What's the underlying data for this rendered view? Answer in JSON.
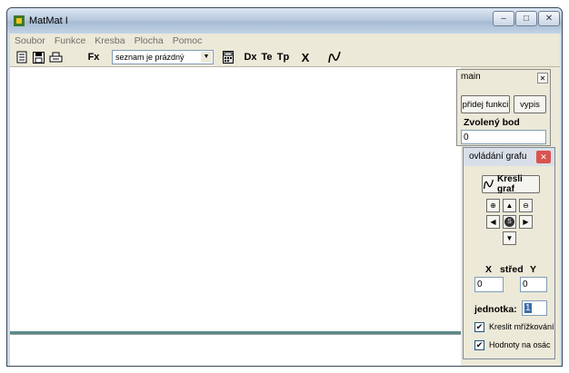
{
  "window": {
    "title": "MatMat I"
  },
  "menu": [
    "Soubor",
    "Funkce",
    "Kresba",
    "Plocha",
    "Pomoc"
  ],
  "toolbar": {
    "fx_label": "Fx",
    "function_select": "seznam je prázdný",
    "dx_label": "Dx",
    "te_label": "Te",
    "tp_label": "Tp",
    "x_label": "X",
    "graph_label": "N/"
  },
  "main_panel": {
    "title": "main",
    "add_function": "přidej funkci",
    "list_button": "vypis",
    "selected_point_label": "Zvolený bod",
    "selected_point_value": "0"
  },
  "graph_panel": {
    "title": "ovládání grafu",
    "draw_button": "Kresli graf",
    "x_label": "X",
    "center_label": "střed",
    "y_label": "Y",
    "x_value": "0",
    "y_value": "0",
    "unit_label": "jednotka:",
    "unit_value": "1",
    "grid_label": "Kreslit mřížkování",
    "grid_checked": true,
    "axis_values_label": "Hodnoty na osác",
    "axis_values_checked": true
  }
}
